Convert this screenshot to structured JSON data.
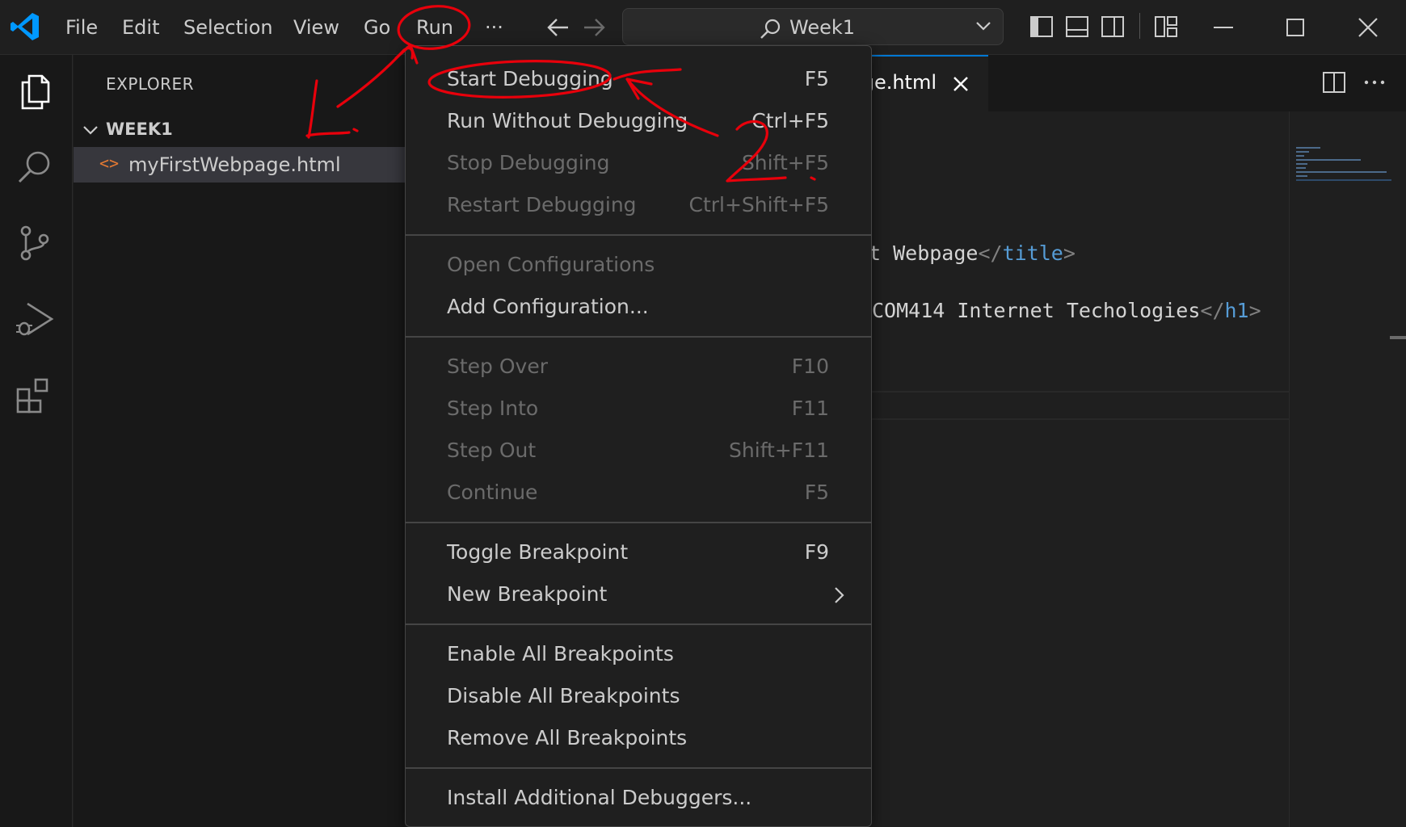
{
  "titlebar": {
    "menus": [
      "File",
      "Edit",
      "Selection",
      "View",
      "Go",
      "Run"
    ],
    "more": "···",
    "command_center": "Week1"
  },
  "sidebar": {
    "title": "EXPLORER",
    "folder": "WEEK1",
    "file_icon": "<>",
    "file": "myFirstWebpage.html"
  },
  "tab": {
    "label": "ge.html",
    "close": "✕"
  },
  "code": {
    "line1_text": "t Webpage",
    "line1_close_tag": "title",
    "line2_text": "COM414 Internet Techologies",
    "line2_close_tag": "h1"
  },
  "run_menu": {
    "items": [
      {
        "label": "Start Debugging",
        "key": "F5"
      },
      {
        "label": "Run Without Debugging",
        "key": "Ctrl+F5"
      },
      {
        "label": "Stop Debugging",
        "key": "Shift+F5"
      },
      {
        "label": "Restart Debugging",
        "key": "Ctrl+Shift+F5"
      },
      {
        "label": "Open Configurations",
        "key": ""
      },
      {
        "label": "Add Configuration...",
        "key": ""
      },
      {
        "label": "Step Over",
        "key": "F10"
      },
      {
        "label": "Step Into",
        "key": "F11"
      },
      {
        "label": "Step Out",
        "key": "Shift+F11"
      },
      {
        "label": "Continue",
        "key": "F5"
      },
      {
        "label": "Toggle Breakpoint",
        "key": "F9"
      },
      {
        "label": "New Breakpoint",
        "key": ""
      },
      {
        "label": "Enable All Breakpoints",
        "key": ""
      },
      {
        "label": "Disable All Breakpoints",
        "key": ""
      },
      {
        "label": "Remove All Breakpoints",
        "key": ""
      },
      {
        "label": "Install Additional Debuggers...",
        "key": ""
      }
    ]
  },
  "annotation": {
    "color": "#e8000b",
    "step1": "1.",
    "step2": "2."
  },
  "colors": {
    "accent": "#0078d4",
    "html_icon": "#e37933",
    "tag": "#569cd6"
  }
}
